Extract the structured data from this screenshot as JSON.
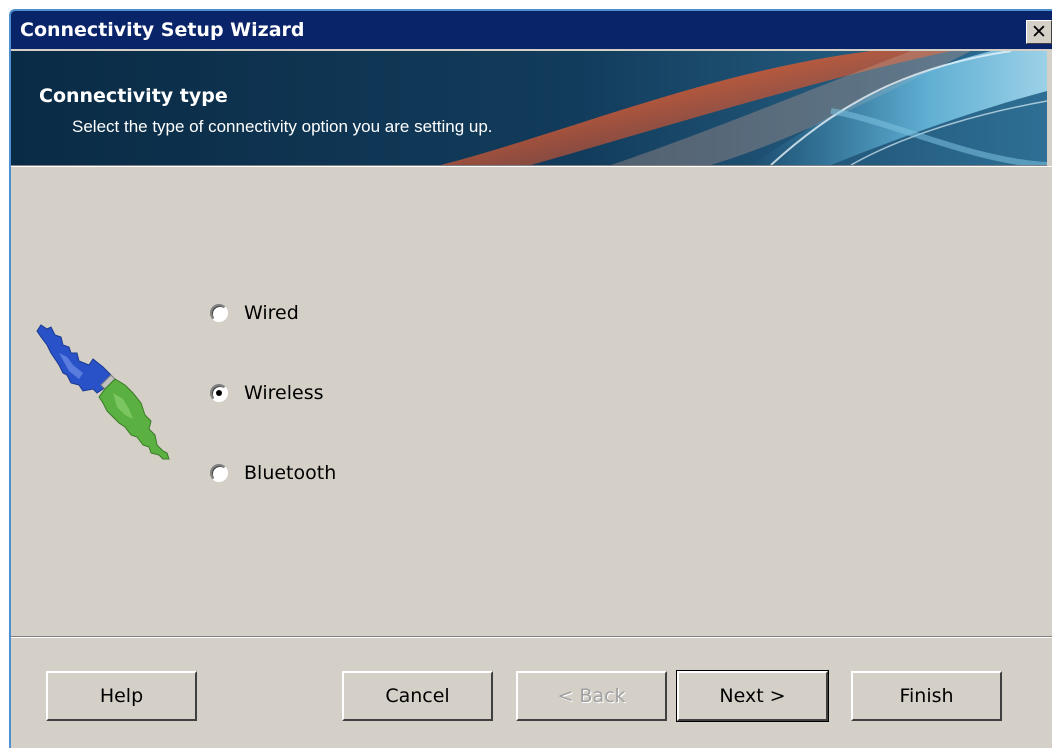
{
  "window": {
    "title": "Connectivity Setup Wizard",
    "close_label": "✕"
  },
  "banner": {
    "title": "Connectivity type",
    "subtitle": "Select the type of connectivity option you are setting up."
  },
  "options": [
    {
      "label": "Wired",
      "selected": false
    },
    {
      "label": "Wireless",
      "selected": true
    },
    {
      "label": "Bluetooth",
      "selected": false
    }
  ],
  "buttons": {
    "help": "Help",
    "cancel": "Cancel",
    "back": "< Back",
    "next": "Next >",
    "finish": "Finish"
  },
  "colors": {
    "titlebar": "#0a246a",
    "dialog_bg": "#d4d0c8",
    "banner_bg": "#0d3553",
    "cable_blue": "#2a52c8",
    "cable_green": "#5ab040"
  },
  "icons": [
    "close-icon",
    "cable-connector-icon"
  ]
}
